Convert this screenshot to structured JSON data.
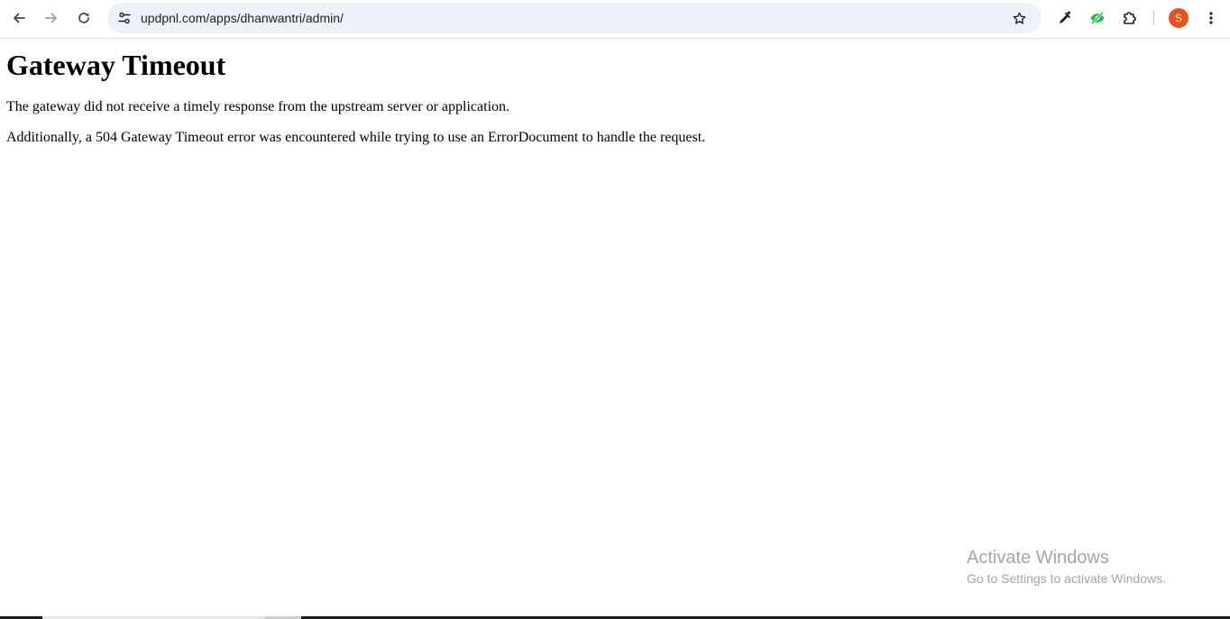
{
  "browser": {
    "url": "updpnl.com/apps/dhanwantri/admin/",
    "profile_initial": "S",
    "icons": {
      "back": "arrow-left-icon",
      "forward": "arrow-right-icon",
      "reload": "reload-icon",
      "site_info": "tune-icon",
      "bookmark": "star-icon",
      "extension1": "eyedropper-icon",
      "extension2": "eye-slash-icon",
      "extensions": "puzzle-icon",
      "menu": "kebab-menu-icon"
    },
    "colors": {
      "omnibox_bg": "#edf2fa",
      "avatar_bg": "#e8501e",
      "extension2_color": "#1db954"
    }
  },
  "page": {
    "heading": "Gateway Timeout",
    "paragraph1": "The gateway did not receive a timely response from the upstream server or application.",
    "paragraph2": "Additionally, a 504 Gateway Timeout error was encountered while trying to use an ErrorDocument to handle the request."
  },
  "watermark": {
    "title": "Activate Windows",
    "subtitle": "Go to Settings to activate Windows."
  }
}
